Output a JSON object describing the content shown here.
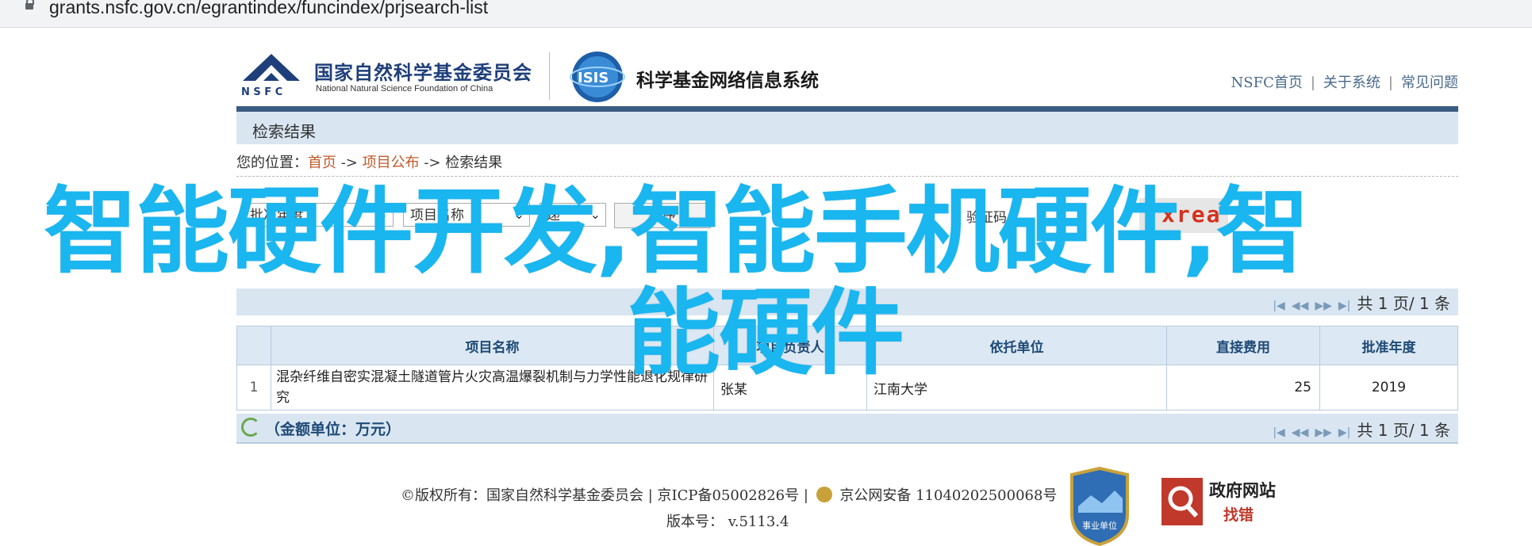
{
  "browser": {
    "url": "grants.nsfc.gov.cn/egrantindex/funcindex/prjsearch-list"
  },
  "header": {
    "nsfc_name_cn": "国家自然科学基金委员会",
    "nsfc_name_en": "National Natural Science Foundation of China",
    "nsfc_abbr": "N S F C",
    "isis_abbr": "ISIS",
    "system_name": "科学基金网络信息系统",
    "links": [
      "NSFC首页",
      "关于系统",
      "常见问题"
    ]
  },
  "section": {
    "title": "检索结果"
  },
  "breadcrumb": {
    "prefix": "您的位置：",
    "items": [
      "首页",
      "项目公布",
      "检索结果"
    ],
    "separator": " -> "
  },
  "filters": {
    "select1": "批准年度",
    "select2": "项目名称",
    "select3": "递",
    "sort_button": "排序",
    "captcha_label": "验证码",
    "captcha_text": "xrea"
  },
  "table": {
    "columns": [
      "",
      "项目名称",
      "项目负责人",
      "依托单位",
      "直接费用",
      "批准年度"
    ],
    "rows": [
      {
        "index": "1",
        "name": "混杂纤维自密实混凝土隧道管片火灾高温爆裂机制与力学性能退化规律研究",
        "leader": "张某",
        "org": "江南大学",
        "cost": "25",
        "year": "2019"
      }
    ]
  },
  "pager": {
    "text": "共 1 页/ 1 条",
    "nav_icons": [
      "first-page-icon",
      "prev-page-icon",
      "next-page-icon",
      "last-page-icon"
    ]
  },
  "summary": {
    "unit_label": "（金额单位：万元）"
  },
  "footer": {
    "copyright": "©版权所有：国家自然科学基金委员会 | 京ICP备05002826号 |",
    "police": "京公网安备 11040202500068号",
    "version": "版本号：  v.5113.4",
    "badge1_text": "事业单位",
    "badge2_title": "政府网站",
    "badge2_sub": "找错"
  },
  "overlay": {
    "line1": "智能硬件开发,智能手机硬件,智",
    "line2": "能硬件"
  },
  "colors": {
    "accent_blue": "#19b6f0",
    "header_rule": "#3b5b82",
    "table_header": "#dce8f3"
  }
}
